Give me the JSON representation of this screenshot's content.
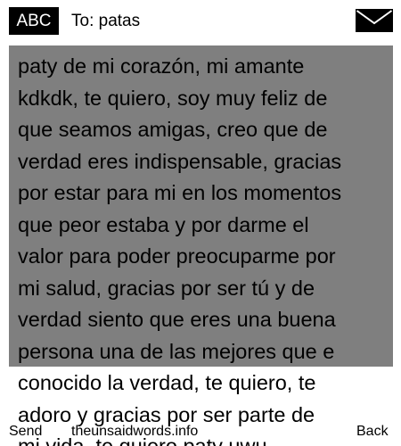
{
  "header": {
    "input_mode": "ABC",
    "recipient": "To: patas",
    "icon": "envelope-icon"
  },
  "message": {
    "body": "paty de mi corazón, mi amante\nkdkdk, te quiero, soy muy feliz de\nque seamos amigas, creo que de\nverdad eres indispensable, gracias\npor estar para mi en los momentos\nque peor estaba y por darme el\nvalor para poder preocuparme por\nmi salud, gracias por ser tú y de\nverdad siento que eres una buena\npersona una de las mejores que e\nconocido la verdad, te quiero, te\nadoro y gracias por ser parte de\nmi vida, te quiero paty uwu"
  },
  "softkeys": {
    "left": "Send",
    "center": "theunsaidwords.info",
    "right": "Back"
  },
  "colors": {
    "message_background": "#7f7f7f",
    "badge_background": "#000000",
    "badge_text": "#ffffff"
  }
}
